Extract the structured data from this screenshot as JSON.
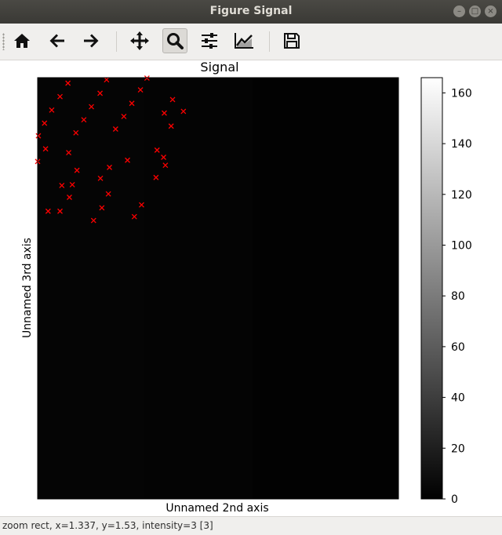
{
  "window": {
    "title": "Figure  Signal"
  },
  "toolbar": {
    "buttons": [
      {
        "name": "home",
        "icon": "home-icon",
        "active": false
      },
      {
        "name": "back",
        "icon": "arrow-left-icon",
        "active": false
      },
      {
        "name": "forward",
        "icon": "arrow-right-icon",
        "active": false
      },
      {
        "name": "pan",
        "icon": "move-icon",
        "active": false
      },
      {
        "name": "zoom",
        "icon": "magnifier-icon",
        "active": true
      },
      {
        "name": "configure-subplots",
        "icon": "sliders-icon",
        "active": false
      },
      {
        "name": "edit-axis",
        "icon": "line-chart-icon",
        "active": false
      },
      {
        "name": "save",
        "icon": "floppy-disk-icon",
        "active": false
      }
    ]
  },
  "status": {
    "text": "zoom rect, x=1.337, y=1.53, intensity=3 [3]"
  },
  "chart_data": {
    "type": "heatmap",
    "title": "Signal",
    "xlabel": "Unnamed 2nd axis",
    "ylabel": "Unnamed 3rd axis",
    "colormap": "gray",
    "colorbar": {
      "ticks": [
        "0",
        "20",
        "40",
        "60",
        "80",
        "100",
        "120",
        "140",
        "160"
      ],
      "min": 0,
      "max": 166
    },
    "markers": {
      "color": "#ff0000",
      "symbol": "x",
      "points": [
        [
          0.084,
          0.013
        ],
        [
          0.191,
          0.005
        ],
        [
          0.303,
          0.001
        ],
        [
          0.062,
          0.045
        ],
        [
          0.173,
          0.037
        ],
        [
          0.285,
          0.029
        ],
        [
          0.039,
          0.077
        ],
        [
          0.149,
          0.069
        ],
        [
          0.261,
          0.061
        ],
        [
          0.374,
          0.052
        ],
        [
          0.019,
          0.108
        ],
        [
          0.128,
          0.1
        ],
        [
          0.239,
          0.092
        ],
        [
          0.351,
          0.084
        ],
        [
          0.404,
          0.08
        ],
        [
          0.002,
          0.138
        ],
        [
          0.106,
          0.131
        ],
        [
          0.216,
          0.122
        ],
        [
          0.37,
          0.115
        ],
        [
          0.022,
          0.169
        ],
        [
          0.086,
          0.178
        ],
        [
          0.331,
          0.172
        ],
        [
          0.0,
          0.199
        ],
        [
          0.109,
          0.22
        ],
        [
          0.249,
          0.196
        ],
        [
          0.349,
          0.189
        ],
        [
          0.067,
          0.256
        ],
        [
          0.199,
          0.213
        ],
        [
          0.062,
          0.317
        ],
        [
          0.096,
          0.254
        ],
        [
          0.174,
          0.239
        ],
        [
          0.328,
          0.237
        ],
        [
          0.088,
          0.284
        ],
        [
          0.196,
          0.276
        ],
        [
          0.029,
          0.317
        ],
        [
          0.178,
          0.309
        ],
        [
          0.288,
          0.302
        ],
        [
          0.155,
          0.339
        ],
        [
          0.268,
          0.33
        ],
        [
          0.354,
          0.208
        ]
      ]
    }
  }
}
